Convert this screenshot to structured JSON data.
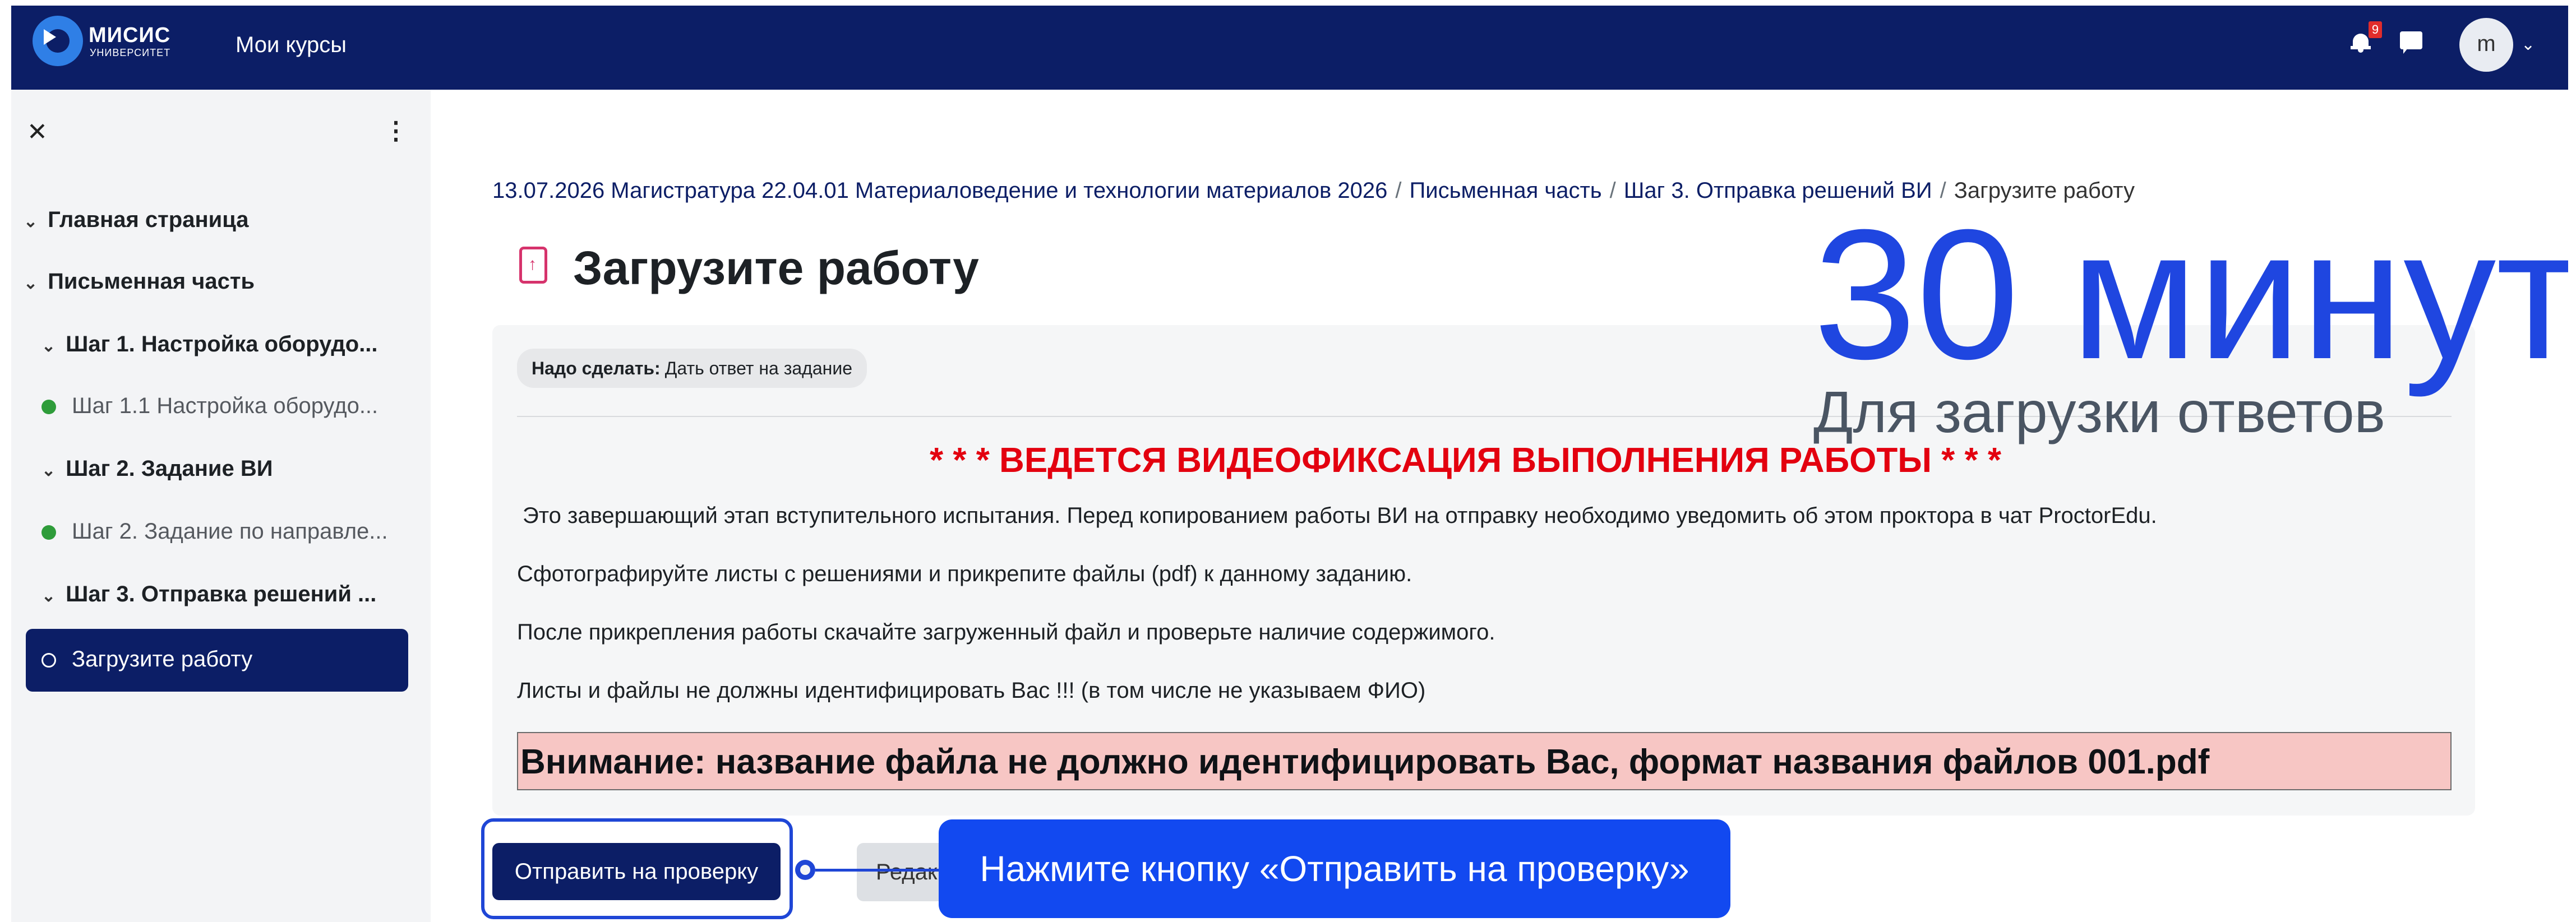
{
  "header": {
    "logo_text": "МИСИС",
    "logo_sub": "УНИВЕРСИТЕТ",
    "nav_courses": "Мои курсы",
    "notification_count": "9",
    "avatar_letter": "m",
    "avatar_caret": "⌄"
  },
  "sidebar": {
    "close_glyph": "✕",
    "more_glyph": "⋮",
    "items": [
      {
        "label": "Главная страница",
        "kind": "section"
      },
      {
        "label": "Письменная часть",
        "kind": "section"
      },
      {
        "label": "Шаг 1. Настройка оборудо...",
        "kind": "subsection"
      },
      {
        "label": "Шаг 1.1 Настройка оборудо...",
        "kind": "activity-complete"
      },
      {
        "label": "Шаг 2. Задание ВИ",
        "kind": "subsection"
      },
      {
        "label": "Шаг 2. Задание по направле...",
        "kind": "activity-complete"
      },
      {
        "label": "Шаг 3. Отправка решений ...",
        "kind": "subsection"
      },
      {
        "label": "Загрузите работу",
        "kind": "activity-current"
      }
    ]
  },
  "breadcrumb": {
    "items": [
      "13.07.2026 Магистратура 22.04.01 Материаловедение и технологии материалов 2026",
      "Письменная часть",
      "Шаг 3. Отправка решений ВИ",
      "Загрузите работу"
    ],
    "separator": "/"
  },
  "page": {
    "title": "Загрузите работу",
    "todo_label": "Надо сделать:",
    "todo_value": "Дать ответ на задание",
    "warning": "* * * ВЕДЕТСЯ ВИДЕОФИКСАЦИЯ ВЫПОЛНЕНИЯ РАБОТЫ * * *",
    "paragraphs": [
      "Это завершающий этап вступительного испытания. Перед копированием работы ВИ на отправку необходимо уведомить об этом проктора в чат ProctorEdu.",
      "Сфотографируйте листы с решениями и прикрепите файлы (pdf) к данному заданию.",
      "После прикрепления работы скачайте загруженный файл и проверьте наличие содержимого.",
      "Листы и файлы не должны идентифицировать Вас !!! (в том числе не указываем ФИО)"
    ],
    "alert": "Внимание: название файла не должно идентифицировать Вас, формат названия файлов 001.pdf",
    "submit_label": "Отправить на проверку",
    "edit_label": "Редак"
  },
  "overlay": {
    "time": "30 минут",
    "time_subtitle": "Для загрузки ответов",
    "callout": "Нажмите кнопку «Отправить на проверку»"
  },
  "colors": {
    "navbar": "#0c1e66",
    "accent_blue": "#1f46e0",
    "warning_red": "#e3000f",
    "alert_bg": "#f7c6c4",
    "complete_green": "#2e9c3a"
  }
}
